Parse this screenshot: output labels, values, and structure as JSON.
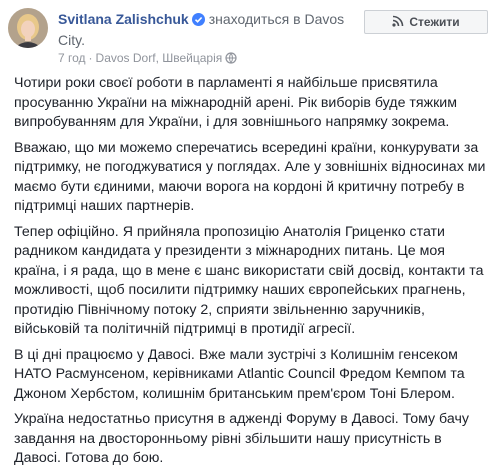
{
  "post": {
    "author": {
      "name": "Svitlana Zalishchuk",
      "status": "знаходиться в Davos City."
    },
    "meta": {
      "date": "7 год",
      "location": "Davos Dorf, Швейцарія"
    },
    "follow_label": "Стежити",
    "paragraphs": [
      "Чотири роки своєї роботи в парламенті я найбільше присвятила просуванню України на міжнародній арені. Рік виборів буде тяжким випробуванням для України, і для зовнішнього напрямку зокрема.",
      "Вважаю, що ми можемо сперечатись всередині країни, конкурувати за підтримку, не погоджуватися у поглядах. Але у зовнішніх відносинах ми маємо бути єдиними, маючи ворога на кордоні й критичну потребу в підтримці наших партнерів.",
      "Тепер офіційно. Я прийняла пропозицію Анатолія Гриценко стати радником кандидата у президенти з міжнародних питань. Це моя країна, і я рада, що в мене є шанс використати свій досвід, контакти та можливості, щоб посилити підтримку наших європейських прагнень, протидію Північному потоку 2, сприяти звільненню заручників, військовій та політичній підтримці в протидії агресії.",
      "В ці дні працюємо у Давосі. Вже мали зустрічі з Колишнім генсеком НАТО Расмунсеном, керівниками Atlantic Council Фредом Кемпом та Джоном Хербстом, колишнім британським прем'єром Тоні Блером.",
      "Україна недостатньо присутня в адженді Форуму в Давосі. Тому бачу завдання на двосторонньому рівні збільшити нашу присутність в Давосі. Готова до бою."
    ]
  },
  "colors": {
    "name": "#385898",
    "verified": "#4080ff",
    "meta": "#90949c",
    "text": "#1d2129"
  },
  "icons": [
    "avatar",
    "verified-badge-icon",
    "globe-icon",
    "rss-icon"
  ]
}
